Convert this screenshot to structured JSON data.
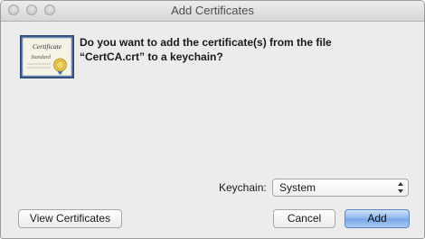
{
  "window": {
    "title": "Add Certificates"
  },
  "message": {
    "line1": "Do you want to add the certificate(s) from the file",
    "line2": "“CertCA.crt” to a keychain?"
  },
  "icon": {
    "name": "certificate-icon",
    "title_text": "Certificate",
    "subtitle_text": "Standard"
  },
  "keychain": {
    "label": "Keychain:",
    "selected": "System"
  },
  "buttons": {
    "view_certificates": "View Certificates",
    "cancel": "Cancel",
    "add": "Add"
  },
  "colors": {
    "default_button": "#77a6e6",
    "window_bg": "#ececec"
  }
}
